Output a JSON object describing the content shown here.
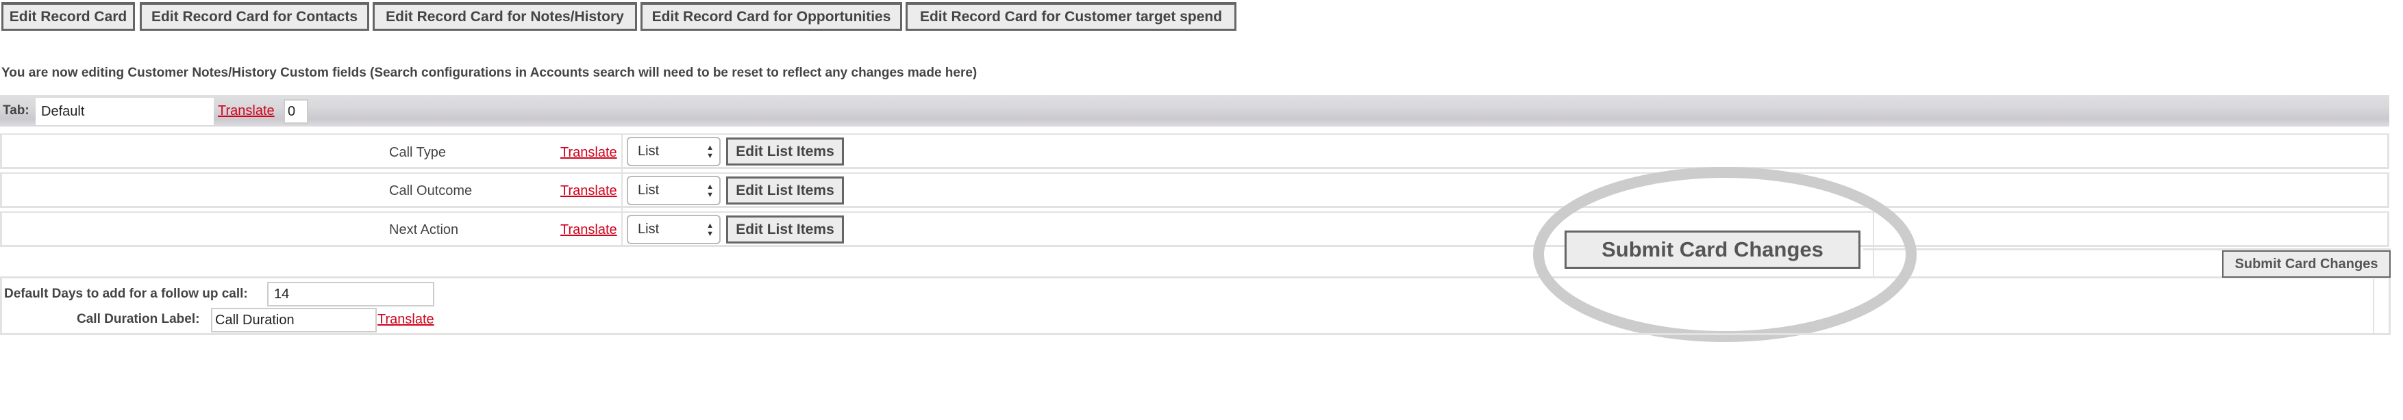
{
  "toolbar": {
    "buttons": [
      {
        "label": "Edit Record Card"
      },
      {
        "label": "Edit Record Card for Contacts"
      },
      {
        "label": "Edit Record Card for Notes/History"
      },
      {
        "label": "Edit Record Card for Opportunities"
      },
      {
        "label": "Edit Record Card for Customer target spend"
      }
    ]
  },
  "notice": "You are now editing Customer Notes/History Custom fields (Search configurations in Accounts search will need to be reset to reflect any changes made here)",
  "tab": {
    "label": "Tab:",
    "name_value": "Default",
    "translate": "Translate",
    "order_value": "0"
  },
  "fields": [
    {
      "label": "Call Type",
      "translate": "Translate",
      "type": "List",
      "edit_label": "Edit List Items"
    },
    {
      "label": "Call Outcome",
      "translate": "Translate",
      "type": "List",
      "edit_label": "Edit List Items"
    },
    {
      "label": "Next Action",
      "translate": "Translate",
      "type": "List",
      "edit_label": "Edit List Items"
    }
  ],
  "submit": {
    "zoomed_label": "Submit Card Changes",
    "label": "Submit Card Changes"
  },
  "settings": {
    "followup_label": "Default Days to add for a follow up call:",
    "followup_value": "14",
    "duration_label": "Call Duration Label:",
    "duration_value": "Call Duration",
    "translate": "Translate"
  },
  "colors": {
    "link": "#d0021b",
    "button_bg": "#ececec",
    "button_border": "#666666",
    "highlight_ring": "#cccccc"
  }
}
